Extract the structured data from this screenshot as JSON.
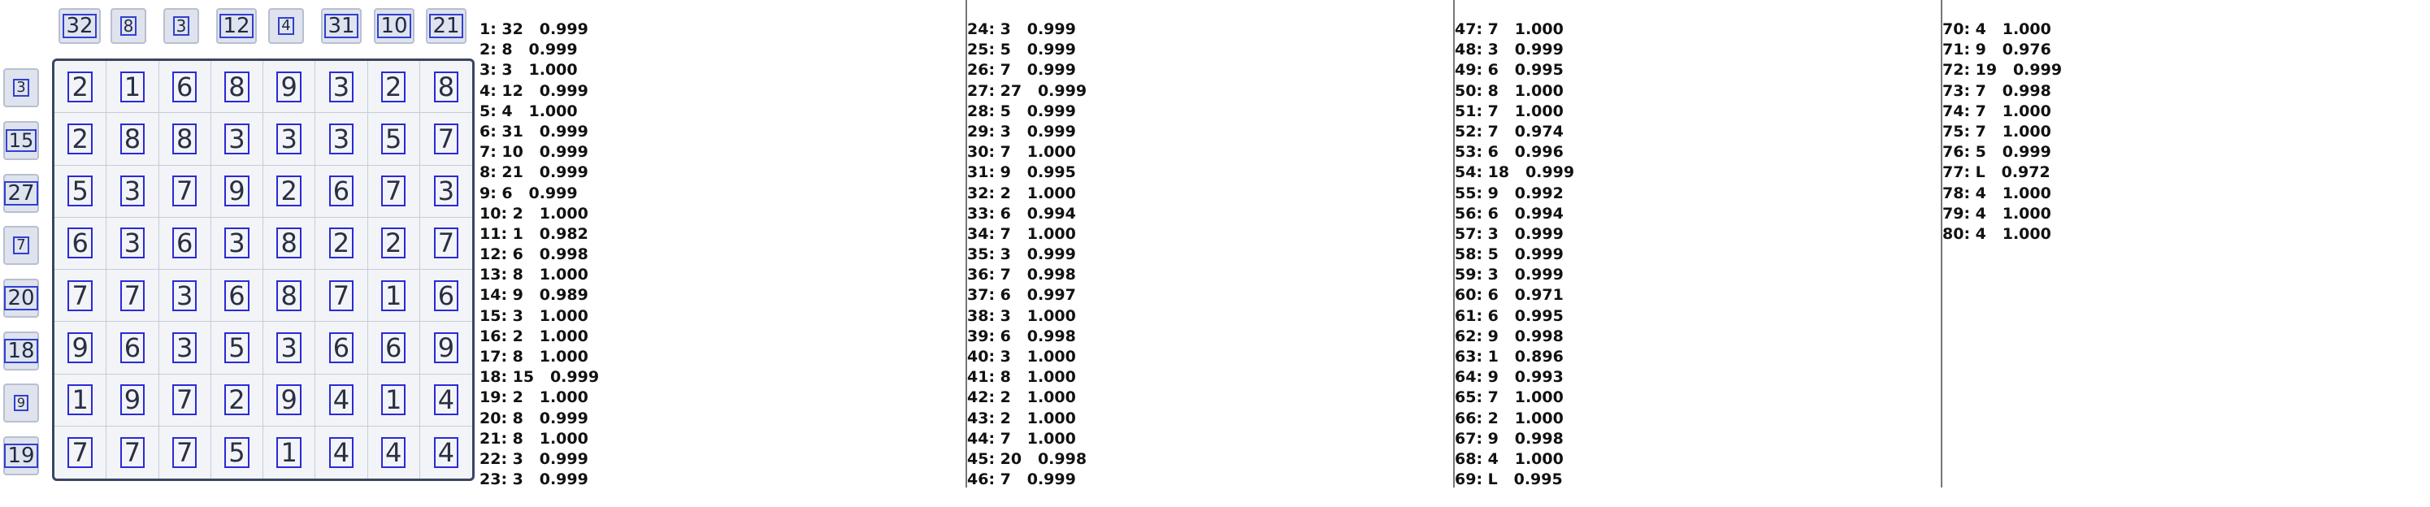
{
  "col_hints": [
    "32",
    "8",
    "3",
    "12",
    "4",
    "31",
    "10",
    "21"
  ],
  "row_hints": [
    "3",
    "15",
    "27",
    "7",
    "20",
    "18",
    "9",
    "19"
  ],
  "grid": [
    [
      "2",
      "1",
      "6",
      "8",
      "9",
      "3",
      "2",
      "8"
    ],
    [
      "2",
      "8",
      "8",
      "3",
      "3",
      "3",
      "5",
      "7"
    ],
    [
      "5",
      "3",
      "7",
      "9",
      "2",
      "6",
      "7",
      "3"
    ],
    [
      "6",
      "3",
      "6",
      "3",
      "8",
      "2",
      "2",
      "7"
    ],
    [
      "7",
      "7",
      "3",
      "6",
      "8",
      "7",
      "1",
      "6"
    ],
    [
      "9",
      "6",
      "3",
      "5",
      "3",
      "6",
      "6",
      "9"
    ],
    [
      "1",
      "9",
      "7",
      "2",
      "9",
      "4",
      "1",
      "4"
    ],
    [
      "7",
      "7",
      "7",
      "5",
      "1",
      "4",
      "4",
      "4"
    ]
  ],
  "results_columns": [
    [
      "1: 32   0.999",
      "2: 8   0.999",
      "3: 3   1.000",
      "4: 12   0.999",
      "5: 4   1.000",
      "6: 31   0.999",
      "7: 10   0.999",
      "8: 21   0.999",
      "9: 6   0.999",
      "10: 2   1.000",
      "11: 1   0.982",
      "12: 6   0.998",
      "13: 8   1.000",
      "14: 9   0.989",
      "15: 3   1.000",
      "16: 2   1.000",
      "17: 8   1.000",
      "18: 15   0.999",
      "19: 2   1.000",
      "20: 8   0.999",
      "21: 8   1.000",
      "22: 3   0.999",
      "23: 3   0.999"
    ],
    [
      "24: 3   0.999",
      "25: 5   0.999",
      "26: 7   0.999",
      "27: 27   0.999",
      "28: 5   0.999",
      "29: 3   0.999",
      "30: 7   1.000",
      "31: 9   0.995",
      "32: 2   1.000",
      "33: 6   0.994",
      "34: 7   1.000",
      "35: 3   0.999",
      "36: 7   0.998",
      "37: 6   0.997",
      "38: 3   1.000",
      "39: 6   0.998",
      "40: 3   1.000",
      "41: 8   1.000",
      "42: 2   1.000",
      "43: 2   1.000",
      "44: 7   1.000",
      "45: 20   0.998",
      "46: 7   0.999"
    ],
    [
      "47: 7   1.000",
      "48: 3   0.999",
      "49: 6   0.995",
      "50: 8   1.000",
      "51: 7   1.000",
      "52: 7   0.974",
      "53: 6   0.996",
      "54: 18   0.999",
      "55: 9   0.992",
      "56: 6   0.994",
      "57: 3   0.999",
      "58: 5   0.999",
      "59: 3   0.999",
      "60: 6   0.971",
      "61: 6   0.995",
      "62: 9   0.998",
      "63: 1   0.896",
      "64: 9   0.993",
      "65: 7   1.000",
      "66: 2   1.000",
      "67: 9   0.998",
      "68: 4   1.000",
      "69: L   0.995"
    ],
    [
      "70: 4   1.000",
      "71: 9   0.976",
      "72: 19   0.999",
      "73: 7   0.998",
      "74: 7   1.000",
      "75: 7   1.000",
      "76: 5   0.999",
      "77: L   0.972",
      "78: 4   1.000",
      "79: 4   1.000",
      "80: 4   1.000"
    ]
  ]
}
